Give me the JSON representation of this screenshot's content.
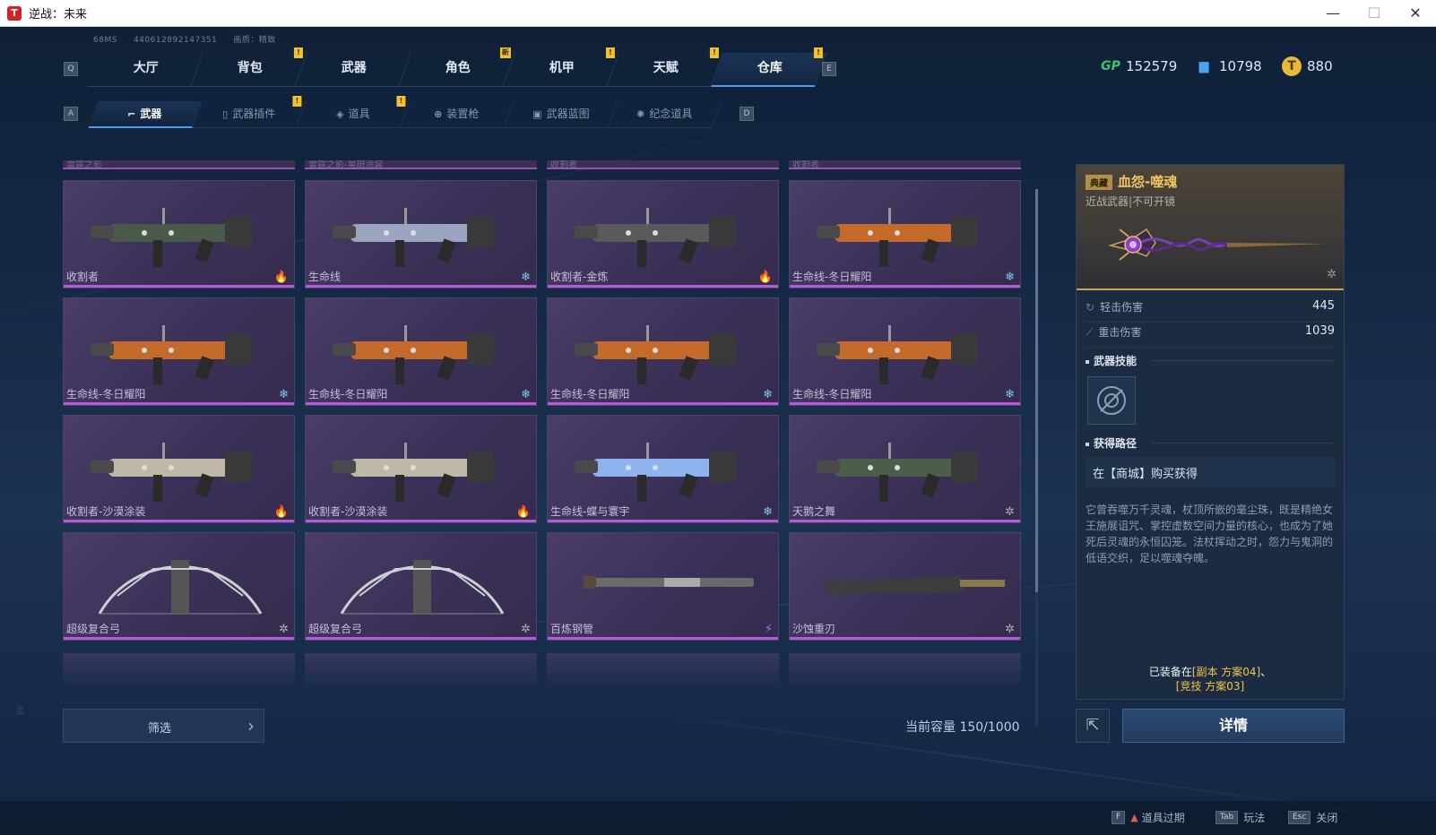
{
  "window": {
    "title": "逆战：未来",
    "min": "—",
    "max": "☐",
    "close": "✕"
  },
  "top_info": {
    "ping": "68MS",
    "uid": "440612892147351",
    "quality": "画质：精致"
  },
  "main_nav": {
    "prev_key": "Q",
    "next_key": "E",
    "tabs": [
      {
        "label": "大厅",
        "badge": ""
      },
      {
        "label": "背包",
        "badge": "!"
      },
      {
        "label": "武器",
        "badge": ""
      },
      {
        "label": "角色",
        "badge": "新"
      },
      {
        "label": "机甲",
        "badge": "!"
      },
      {
        "label": "天赋",
        "badge": "!"
      },
      {
        "label": "仓库",
        "badge": "!"
      }
    ],
    "active_index": 6
  },
  "sub_nav": {
    "prev_key": "A",
    "next_key": "D",
    "tabs": [
      {
        "label": "武器",
        "icon": "⌐",
        "badge": ""
      },
      {
        "label": "武器插件",
        "icon": "▯",
        "badge": "!"
      },
      {
        "label": "道具",
        "icon": "◈",
        "badge": "!"
      },
      {
        "label": "装置枪",
        "icon": "⊕",
        "badge": ""
      },
      {
        "label": "武器蓝图",
        "icon": "▣",
        "badge": ""
      },
      {
        "label": "纪念道具",
        "icon": "✺",
        "badge": ""
      }
    ],
    "active_index": 0
  },
  "currency": {
    "gp": "152579",
    "ticket": "10798",
    "coin": "880",
    "gp_icon": "GP",
    "ticket_icon": "▆",
    "coin_icon": "T"
  },
  "partial_row": [
    "雷霆之影",
    "雷霆之影-晃斑涂装",
    "收割者",
    "收割者"
  ],
  "items": [
    {
      "name": "收割者",
      "element": "🔥",
      "type": "fire"
    },
    {
      "name": "生命线",
      "element": "❄",
      "type": "ice"
    },
    {
      "name": "收割者-金炼",
      "element": "🔥",
      "type": "fire"
    },
    {
      "name": "生命线-冬日耀阳",
      "element": "❄",
      "type": "ice"
    },
    {
      "name": "生命线-冬日耀阳",
      "element": "❄",
      "type": "ice"
    },
    {
      "name": "生命线-冬日耀阳",
      "element": "❄",
      "type": "ice"
    },
    {
      "name": "生命线-冬日耀阳",
      "element": "❄",
      "type": "ice"
    },
    {
      "name": "生命线-冬日耀阳",
      "element": "❄",
      "type": "ice"
    },
    {
      "name": "收割者-沙漠涂装",
      "element": "🔥",
      "type": "fire"
    },
    {
      "name": "收割者-沙漠涂装",
      "element": "🔥",
      "type": "fire"
    },
    {
      "name": "生命线-蝶与寰宇",
      "element": "❄",
      "type": "ice"
    },
    {
      "name": "天鹅之舞",
      "element": "✲",
      "type": "neutral"
    },
    {
      "name": "超级复合弓",
      "element": "✲",
      "type": "neutral"
    },
    {
      "name": "超级复合弓",
      "element": "✲",
      "type": "neutral"
    },
    {
      "name": "百炼钢管",
      "element": "⚡",
      "type": "bolt"
    },
    {
      "name": "沙蚀重刃",
      "element": "✲",
      "type": "neutral"
    }
  ],
  "filter": {
    "label": "筛选",
    "chevron": "›"
  },
  "capacity": {
    "text": "当前容量 150/1000"
  },
  "detail": {
    "rarity": "典藏",
    "name": "血怨-噬魂",
    "subtitle": "近战武器|不可开镜",
    "stats": [
      {
        "label": "轻击伤害",
        "value": "445",
        "icon": "↻"
      },
      {
        "label": "重击伤害",
        "value": "1039",
        "icon": "⟋"
      }
    ],
    "skills_title": "武器技能",
    "route_title": "获得路径",
    "route_text": "在【商城】购买获得",
    "description": "它曾吞噬万千灵魂，杖顶所嵌的毫尘珠，既是精绝女王施展诅咒、掌控虚数空间力量的核心，也成为了她死后灵魂的永恒囚笼。法杖挥动之时，怨力与鬼洞的低语交织，足以噬魂夺魄。",
    "equipped_prefix": "已装备在",
    "equipped_a": "[副本 方案04]",
    "equipped_sep": "、",
    "equipped_b": "[竞技 方案03]"
  },
  "buttons": {
    "share": "⇱",
    "detail": "详情"
  },
  "footer": [
    {
      "key": "F",
      "label": "道具过期",
      "warn": "▲"
    },
    {
      "key": "Tab",
      "label": "玩法",
      "warn": ""
    },
    {
      "key": "Esc",
      "label": "关闭",
      "warn": ""
    }
  ],
  "colors": {
    "accent": "#4c9cf0",
    "rarity_gold": "#f3c560",
    "card_purple": "#b55bd9",
    "badge_yellow": "#f2c230",
    "fire": "#f08a2a",
    "ice": "#7ec8f0"
  }
}
